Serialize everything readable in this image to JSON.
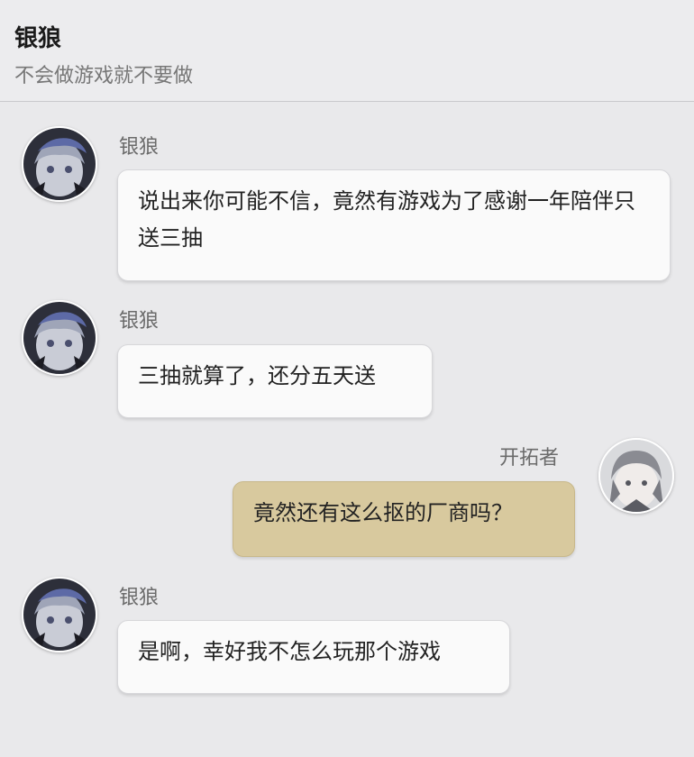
{
  "header": {
    "title": "银狼",
    "subtitle": "不会做游戏就不要做"
  },
  "messages": [
    {
      "sender": "银狼",
      "text": "说出来你可能不信，竟然有游戏为了感谢一年陪伴只送三抽",
      "self": false,
      "avatar_icon": "silver-wolf-avatar-icon"
    },
    {
      "sender": "银狼",
      "text": "三抽就算了，还分五天送",
      "self": false,
      "avatar_icon": "silver-wolf-avatar-icon"
    },
    {
      "sender": "开拓者",
      "text": "竟然还有这么抠的厂商吗？",
      "self": true,
      "avatar_icon": "trailblazer-avatar-icon"
    },
    {
      "sender": "银狼",
      "text": "是啊，幸好我不怎么玩那个游戏",
      "self": false,
      "avatar_icon": "silver-wolf-avatar-icon"
    }
  ],
  "colors": {
    "background": "#e9e9eb",
    "bubble_other": "#fafafa",
    "bubble_self": "#d8c99e"
  }
}
